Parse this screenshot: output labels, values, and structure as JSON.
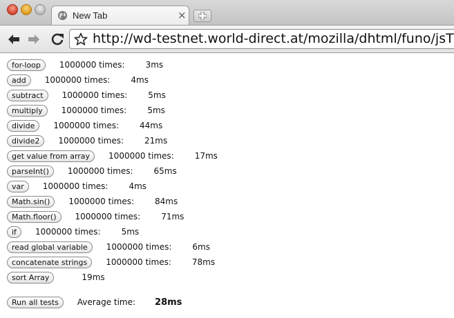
{
  "browser": {
    "tab_title": "New Tab",
    "tab_close_glyph": "×",
    "url": "http://wd-testnet.world-direct.at/mozilla/dhtml/funo/jsTimeTest.htm"
  },
  "tests": [
    {
      "label": "for-loop",
      "times": "1000000 times:",
      "ms": "3ms"
    },
    {
      "label": "add",
      "times": "1000000 times:",
      "ms": "4ms"
    },
    {
      "label": "subtract",
      "times": "1000000 times:",
      "ms": "5ms"
    },
    {
      "label": "multiply",
      "times": "1000000 times:",
      "ms": "5ms"
    },
    {
      "label": "divide",
      "times": "1000000 times:",
      "ms": "44ms"
    },
    {
      "label": "divide2",
      "times": "1000000 times:",
      "ms": "21ms"
    },
    {
      "label": "get value from array",
      "times": "1000000 times:",
      "ms": "17ms"
    },
    {
      "label": "parseInt()",
      "times": "1000000 times:",
      "ms": "65ms"
    },
    {
      "label": "var",
      "times": "1000000 times:",
      "ms": "4ms"
    },
    {
      "label": "Math.sin()",
      "times": "1000000 times:",
      "ms": "84ms"
    },
    {
      "label": "Math.floor()",
      "times": "1000000 times:",
      "ms": "71ms"
    },
    {
      "label": "if",
      "times": "1000000 times:",
      "ms": "5ms"
    },
    {
      "label": "read global variable",
      "times": "1000000 times:",
      "ms": "6ms"
    },
    {
      "label": "concatenate strings",
      "times": "1000000 times:",
      "ms": "78ms"
    },
    {
      "label": "sort Array",
      "ms": "19ms"
    }
  ],
  "footer": {
    "run_all_label": "Run all tests",
    "average_label": "Average time:",
    "average_value": "28ms"
  }
}
